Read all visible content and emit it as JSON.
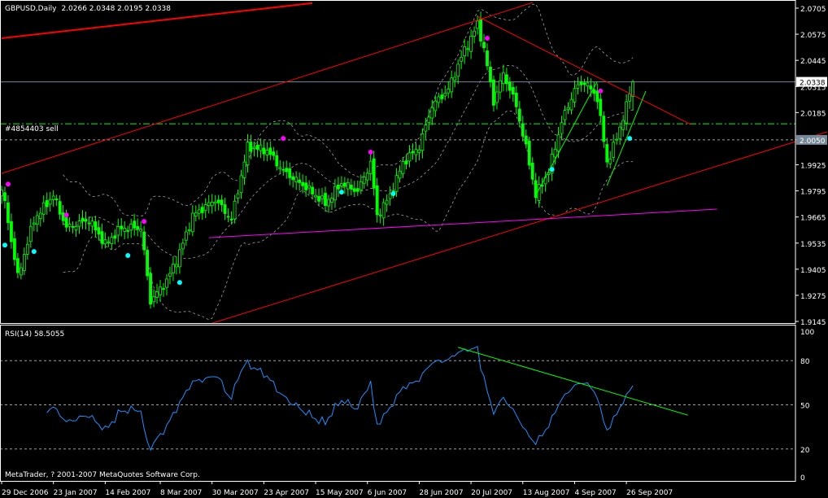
{
  "chart_data": {
    "type": "candlestick",
    "symbol": "GBPUSD",
    "timeframe": "Daily",
    "title": "GBPUSD,Daily",
    "last_ohlc": [
      "2.0266",
      "2.0348",
      "2.0195",
      "2.0338"
    ],
    "price_axis": {
      "ylim": [
        1.9145,
        2.0705
      ],
      "ticks": [
        "2.0705",
        "2.0575",
        "2.0445",
        "2.0315",
        "2.0185",
        "2.0050",
        "1.9925",
        "1.9795",
        "1.9665",
        "1.9535",
        "1.9405",
        "1.9275",
        "1.9145"
      ]
    },
    "current_price_label": "2.0338",
    "order_price_label": "2.0050",
    "order_label": "#4854403 sell",
    "levels": {
      "current": 2.0338,
      "sell_order": 2.0129,
      "pending": 2.0049
    },
    "date_ticks": [
      {
        "i": 0,
        "label": "29 Dec 2006"
      },
      {
        "i": 16,
        "label": "23 Jan 2007"
      },
      {
        "i": 32,
        "label": "14 Feb 2007"
      },
      {
        "i": 49,
        "label": "8 Mar 2007"
      },
      {
        "i": 65,
        "label": "30 Mar 2007"
      },
      {
        "i": 81,
        "label": "23 Apr 2007"
      },
      {
        "i": 97,
        "label": "15 May 2007"
      },
      {
        "i": 113,
        "label": "6 Jun 2007"
      },
      {
        "i": 129,
        "label": "28 Jun 2007"
      },
      {
        "i": 145,
        "label": "20 Jul 2007"
      },
      {
        "i": 161,
        "label": "13 Aug 2007"
      },
      {
        "i": 177,
        "label": "4 Sep 2007"
      },
      {
        "i": 193,
        "label": "26 Sep 2007"
      }
    ],
    "bars": 196,
    "close_path": [
      [
        0,
        1.98
      ],
      [
        1,
        1.9732
      ],
      [
        5,
        1.9367
      ],
      [
        10,
        1.9651
      ],
      [
        16,
        1.9773
      ],
      [
        20,
        1.9611
      ],
      [
        27,
        1.9651
      ],
      [
        32,
        1.9529
      ],
      [
        37,
        1.9611
      ],
      [
        43,
        1.9611
      ],
      [
        46,
        1.9246
      ],
      [
        51,
        1.9347
      ],
      [
        55,
        1.9489
      ],
      [
        59,
        1.9671
      ],
      [
        66,
        1.9752
      ],
      [
        71,
        1.9651
      ],
      [
        76,
        2.0016
      ],
      [
        82,
        1.9996
      ],
      [
        87,
        1.9894
      ],
      [
        94,
        1.9813
      ],
      [
        100,
        1.9732
      ],
      [
        105,
        1.9834
      ],
      [
        110,
        1.9793
      ],
      [
        114,
        1.9935
      ],
      [
        116,
        1.9671
      ],
      [
        120,
        1.9773
      ],
      [
        124,
        1.9935
      ],
      [
        129,
        2.0016
      ],
      [
        133,
        2.0219
      ],
      [
        138,
        2.03
      ],
      [
        142,
        2.0462
      ],
      [
        147,
        2.0624
      ],
      [
        149,
        2.0502
      ],
      [
        152,
        2.0239
      ],
      [
        155,
        2.0381
      ],
      [
        159,
        2.0219
      ],
      [
        163,
        1.9935
      ],
      [
        165,
        1.9773
      ],
      [
        169,
        1.9894
      ],
      [
        173,
        2.0138
      ],
      [
        177,
        2.03
      ],
      [
        180,
        2.034
      ],
      [
        184,
        2.0259
      ],
      [
        187,
        1.9935
      ],
      [
        190,
        2.0056
      ],
      [
        193,
        2.0219
      ],
      [
        195,
        2.0338
      ]
    ],
    "trendlines": [
      {
        "name": "thick-red",
        "color": "#ff0000",
        "width": 2,
        "p1": [
          0,
          2.0555
        ],
        "p2": [
          96,
          2.073
        ]
      },
      {
        "name": "channel-upper",
        "color": "#ff0000",
        "width": 1,
        "p1": [
          0,
          1.9882
        ],
        "p2": [
          164,
          2.0733
        ]
      },
      {
        "name": "channel-lower",
        "color": "#ff0000",
        "width": 1,
        "p1": [
          65,
          1.9136
        ],
        "p2": [
          255,
          2.0089
        ]
      },
      {
        "name": "resistance",
        "color": "#ff0000",
        "width": 1,
        "p1": [
          147,
          2.0664
        ],
        "p2": [
          213,
          2.0125
        ]
      },
      {
        "name": "support-magenta",
        "color": "#ff00ff",
        "width": 1,
        "p1": [
          64,
          1.9562
        ],
        "p2": [
          221,
          1.9704
        ]
      },
      {
        "name": "green-up-1",
        "color": "#00ff00",
        "width": 1,
        "p1": [
          165,
          1.9773
        ],
        "p2": [
          184,
          2.034
        ]
      },
      {
        "name": "green-up-2",
        "color": "#00ff00",
        "width": 1,
        "p1": [
          187,
          1.9821
        ],
        "p2": [
          199,
          2.0292
        ]
      }
    ],
    "markers_magenta": [
      [
        2,
        1.9829
      ],
      [
        20,
        1.9675
      ],
      [
        44,
        1.9643
      ],
      [
        87,
        2.0056
      ],
      [
        114,
        1.9988
      ],
      [
        150,
        2.0555
      ],
      [
        185,
        2.0292
      ]
    ],
    "markers_cyan": [
      [
        1,
        1.9525
      ],
      [
        10,
        1.9493
      ],
      [
        39,
        1.9473
      ],
      [
        55,
        1.9339
      ],
      [
        105,
        1.9789
      ],
      [
        121,
        1.9781
      ],
      [
        170,
        1.9902
      ],
      [
        194,
        2.0056
      ]
    ],
    "bollinger": {
      "period": 20,
      "deviations": 2
    },
    "rsi": {
      "title": "RSI(14) 58.5055",
      "period": 14,
      "ylim": [
        0,
        100
      ],
      "ticks": [
        "100",
        "80",
        "50",
        "20",
        "0"
      ],
      "levels": [
        80,
        50,
        20
      ],
      "trendline": {
        "p1": [
          141,
          89
        ],
        "p2": [
          212,
          43
        ]
      }
    },
    "colors": {
      "candle": "#00ff00",
      "rsi": "#1e90ff",
      "bands": "#a0a0a0",
      "grid": "#a0a0a0"
    }
  },
  "footer": {
    "copyright": "MetaTrader, ? 2001-2007 MetaQuotes Software Corp."
  }
}
